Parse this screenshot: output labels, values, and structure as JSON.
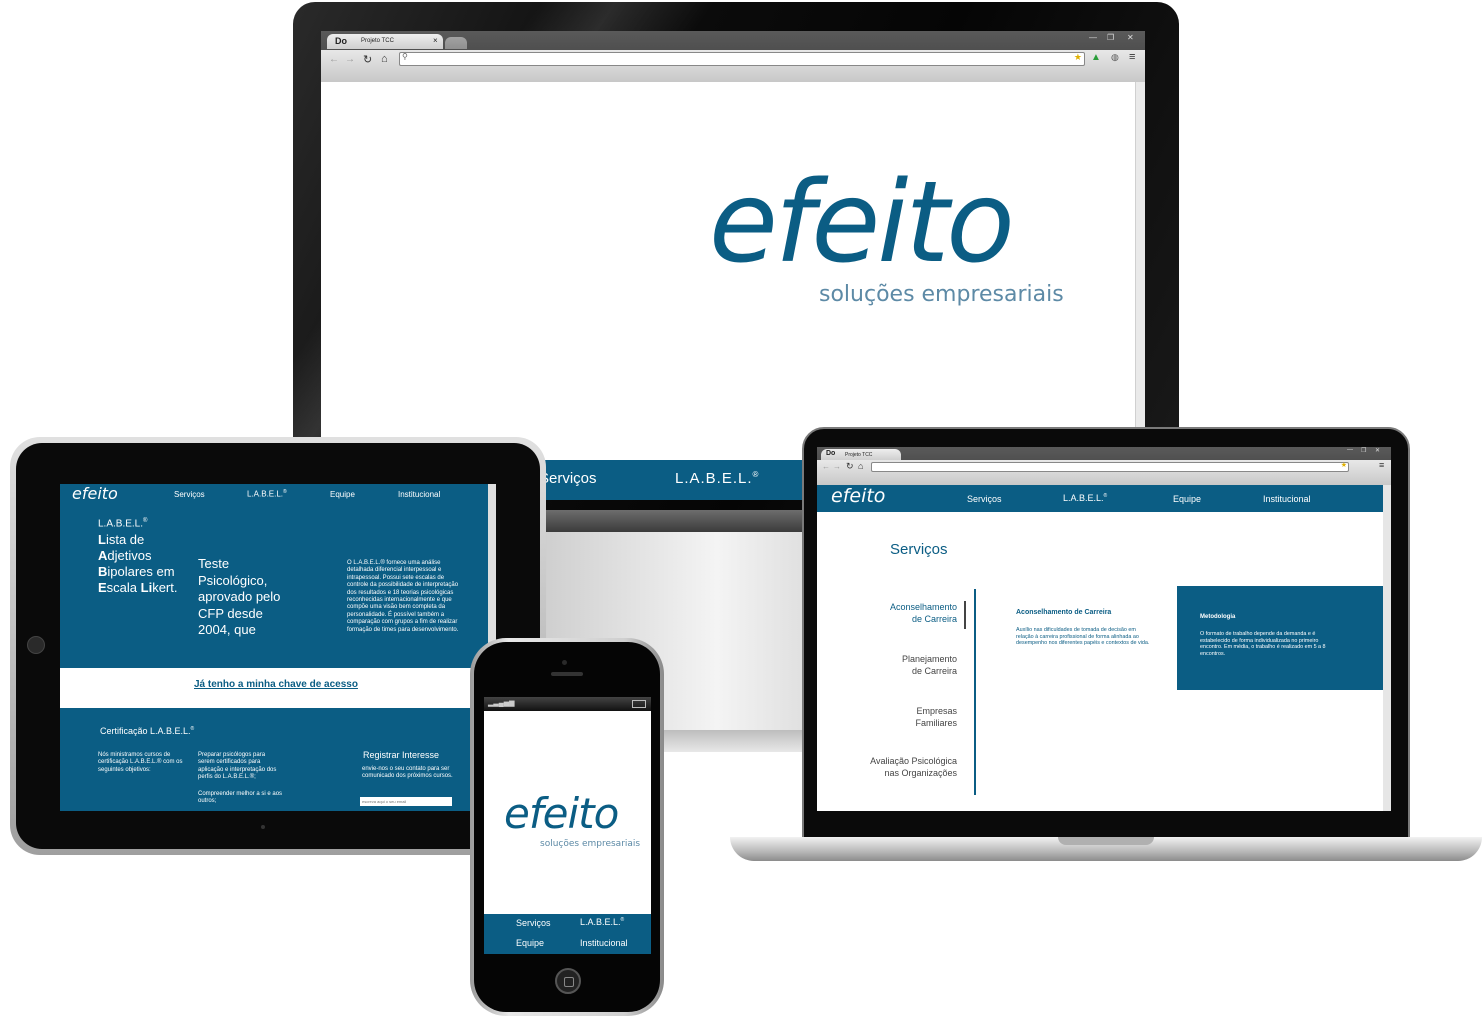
{
  "browser": {
    "logo": "Do",
    "tab_title": "Projeto TCC",
    "address": "",
    "close_glyph": "×",
    "win_min": "—",
    "win_max": "❐",
    "win_close": "✕"
  },
  "monitor": {
    "logo": "efeito",
    "tagline": "soluções empresariais",
    "nav_partial_services": "Serviços",
    "nav_label": "L.A.B.E.L.",
    "reg": "®"
  },
  "tablet": {
    "logo": "efeito",
    "nav": [
      "Serviços",
      "L.A.B.E.L.",
      "Equipe",
      "Institucional"
    ],
    "reg": "®",
    "label_title": "L.A.B.E.L.",
    "acronym": [
      {
        "cap": "L",
        "rest": "ista de"
      },
      {
        "cap": "A",
        "rest": "djetivos"
      },
      {
        "cap": "B",
        "rest": "ipolares em"
      },
      {
        "cap": "E",
        "rest": "scala "
      },
      {
        "cap": "Li",
        "rest": "kert."
      }
    ],
    "teste_lines": [
      "Teste",
      "Psicológico,",
      "aprovado pelo",
      "CFP desde",
      "2004, que"
    ],
    "description": "O L.A.B.E.L.® fornece uma análise detalhada diferencial interpessoal e intrapessoal. Possui sete escalas de controle da possibilidade de interpretação dos resultados e 18 teorias psicológicas reconhecidas internacionalmente e que compõe uma visão bem completa da personalidade. É possível também a comparação com grupos a fim de realizar formação de times para desenvolvimento.",
    "access_link": "Já tenho a minha chave de acesso",
    "cert_title": "Certificação L.A.B.E.L.",
    "cert_col1": "Nós ministramos cursos de certificação L.A.B.E.L.® com os seguintes objetivos:",
    "cert_col2a": "Preparar psicólogos para serem certificados para aplicação e interpretação dos perfis do L.A.B.E.L.®;",
    "cert_col2b": "Compreender melhor a si e aos outros;",
    "register_title": "Registrar Interesse",
    "register_text": "envie-nos o seu contato para ser comunicado dos próximos cursos.",
    "email_placeholder": "escreva aqui o seu email"
  },
  "laptop": {
    "logo": "efeito",
    "nav": [
      "Serviços",
      "L.A.B.E.L.",
      "Equipe",
      "Institucional"
    ],
    "reg": "®",
    "page_title": "Serviços",
    "menu": [
      {
        "l1": "Aconselhamento",
        "l2": "de Carreira"
      },
      {
        "l1": "Planejamento",
        "l2": "de Carreira"
      },
      {
        "l1": "Empresas",
        "l2": "Familiares"
      },
      {
        "l1": "Avaliação Psicológica",
        "l2": "nas Organizações"
      }
    ],
    "detail_title": "Aconselhamento de Carreira",
    "detail_text": "Auxílio nas dificuldades de tomada de decisão em relação à carreira profissional de forma alinhada ao desempenho nos diferentes papéis e contextos de vida.",
    "method_title": "Metodologia",
    "method_text": "O formato de trabalho depende da demanda e é estabelecido de forma individualizada no primeiro encontro.  Em média, o trabalho é realizado em 5 a 8 encontros."
  },
  "phone": {
    "logo": "efeito",
    "tagline": "soluções empresariais",
    "nav": [
      "Serviços",
      "L.A.B.E.L.",
      "Equipe",
      "Institucional"
    ],
    "reg": "®"
  },
  "colors": {
    "brand_blue": "#0b5d84"
  }
}
